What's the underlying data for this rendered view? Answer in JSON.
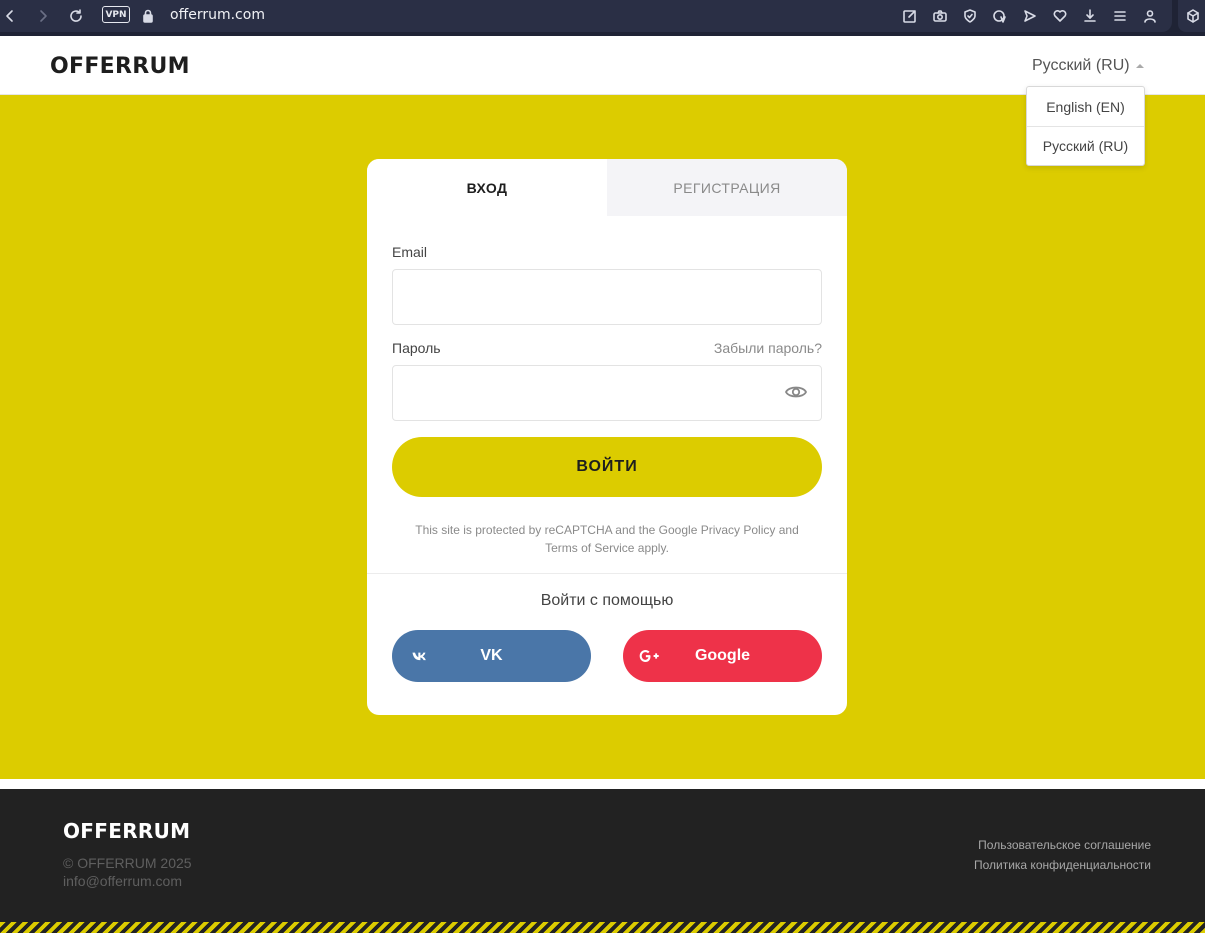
{
  "browser": {
    "vpn_label": "VPN",
    "url": "offerrum.com"
  },
  "header": {
    "logo": "OFFERRUM",
    "language_current": "Русский (RU)",
    "language_options": [
      "English (EN)",
      "Русский (RU)"
    ]
  },
  "login": {
    "tabs": {
      "login": "ВХОД",
      "register": "РЕГИСТРАЦИЯ"
    },
    "email_label": "Email",
    "email_value": "",
    "password_label": "Пароль",
    "password_value": "",
    "forgot_link": "Забыли пароль?",
    "submit_label": "ВОЙТИ",
    "recaptcha_text": "This site is protected by reCAPTCHA and the Google Privacy Policy and Terms of Service apply.",
    "social_title": "Войти с помощью",
    "vk_label": "VK",
    "google_label": "Google"
  },
  "footer": {
    "logo": "OFFERRUM",
    "copyright": "© OFFERRUM 2025",
    "email": "info@offerrum.com",
    "links": [
      "Пользовательское соглашение",
      "Политика конфиденциальности"
    ]
  },
  "colors": {
    "accent_yellow": "#dccc00",
    "vk_blue": "#4a76a8",
    "google_red": "#ee3249",
    "footer_dark": "#222222"
  }
}
